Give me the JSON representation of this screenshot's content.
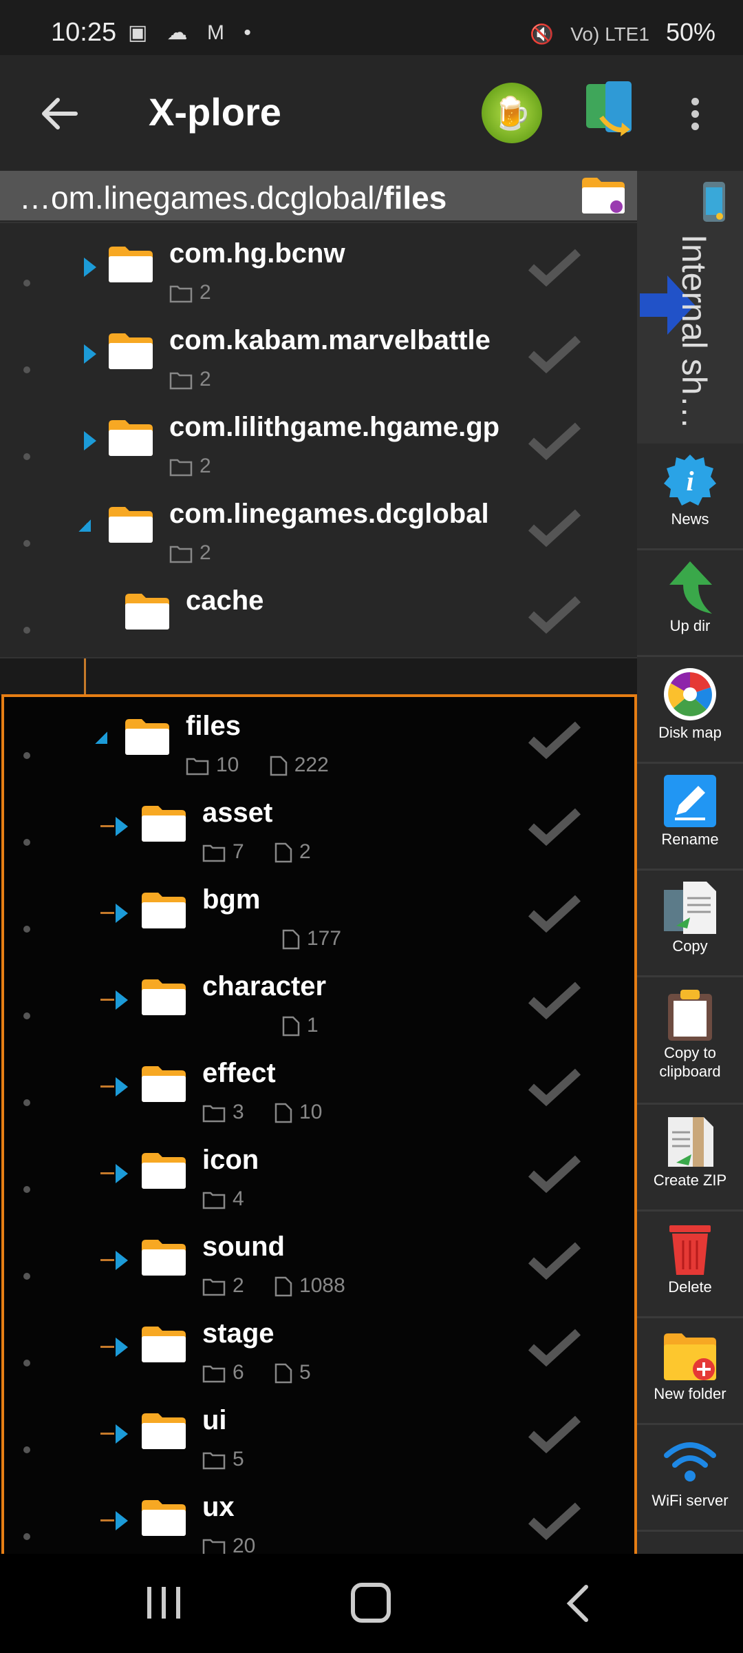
{
  "status_bar": {
    "time": "10:25",
    "left_icons": "▣ ☁ M •",
    "network": "Vo) LTE1",
    "battery": "50%"
  },
  "app_bar": {
    "title": "X-plore",
    "icons": [
      "back-arrow-icon",
      "beer-donate-icon",
      "device-transfer-icon",
      "more-vert-icon"
    ]
  },
  "path_bar": {
    "prefix": "…om.linegames.dcglobal/",
    "current": "files"
  },
  "rows": [
    {
      "name": "",
      "folders": "2",
      "files": ""
    },
    {
      "name": "com.hg.bcnw",
      "folders": "2",
      "files": ""
    },
    {
      "name": "com.kabam.marvelbattle",
      "folders": "2",
      "files": ""
    },
    {
      "name": "com.lilithgame.hgame.gp",
      "folders": "2",
      "files": ""
    },
    {
      "name": "com.linegames.dcglobal",
      "folders": "2",
      "files": ""
    },
    {
      "name": "cache",
      "folders": "",
      "files": ""
    },
    {
      "name": "files",
      "folders": "10",
      "files": "222"
    },
    {
      "name": "asset",
      "folders": "7",
      "files": "2"
    },
    {
      "name": "bgm",
      "folders": "",
      "files": "177"
    },
    {
      "name": "character",
      "folders": "",
      "files": "1"
    },
    {
      "name": "effect",
      "folders": "3",
      "files": "10"
    },
    {
      "name": "icon",
      "folders": "4",
      "files": ""
    },
    {
      "name": "sound",
      "folders": "2",
      "files": "1088"
    },
    {
      "name": "stage",
      "folders": "6",
      "files": "5"
    },
    {
      "name": "ui",
      "folders": "5",
      "files": ""
    },
    {
      "name": "ux",
      "folders": "20",
      "files": ""
    }
  ],
  "sidebar": {
    "storage_label": "Internal sh…",
    "tools": [
      {
        "label": "News",
        "icon": "info-news-icon"
      },
      {
        "label": "Up dir",
        "icon": "up-dir-arrow-icon"
      },
      {
        "label": "Disk map",
        "icon": "disk-map-icon"
      },
      {
        "label": "Rename",
        "icon": "rename-pencil-icon"
      },
      {
        "label": "Copy",
        "icon": "copy-icon"
      },
      {
        "label": "Copy to clipboard",
        "icon": "clipboard-icon"
      },
      {
        "label": "Create ZIP",
        "icon": "zip-icon"
      },
      {
        "label": "Delete",
        "icon": "trash-icon"
      },
      {
        "label": "New folder",
        "icon": "new-folder-icon"
      },
      {
        "label": "WiFi server",
        "icon": "wifi-icon"
      }
    ]
  },
  "colors": {
    "accent_orange": "#e67e14",
    "expander_blue": "#1c9bd8",
    "folder_yellow": "#f7a823"
  }
}
